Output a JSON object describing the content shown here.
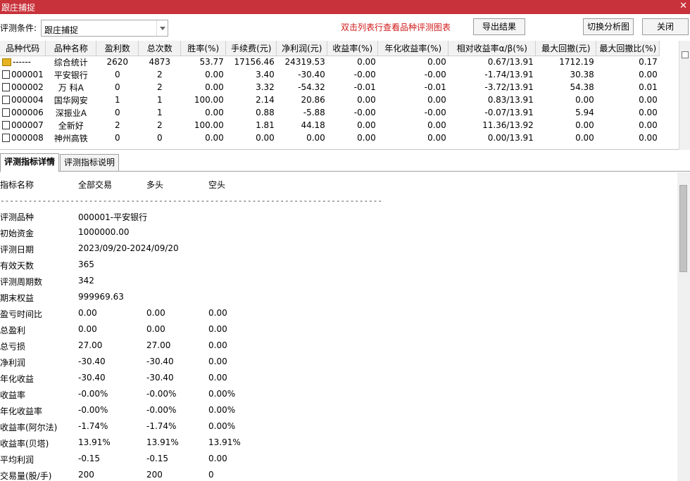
{
  "window": {
    "title": "跟庄捕捉",
    "close_glyph": "✕"
  },
  "toolbar": {
    "cond_label": "评测条件:",
    "cond_value": "跟庄捕捉",
    "hint": "双击列表行查看品种评测图表",
    "export_label": "导出结果",
    "switch_label": "切换分析图",
    "close_label": "关闭"
  },
  "table": {
    "headers": [
      "品种代码",
      "品种名称",
      "盈利数",
      "总次数",
      "胜率(%)",
      "手续费(元)",
      "净利润(元)",
      "收益率(%)",
      "年化收益率(%)",
      "相对收益率α/β(%)",
      "最大回撤(元)",
      "最大回撤比(%)"
    ],
    "rows": [
      [
        "------",
        "综合统计",
        "2620",
        "4873",
        "53.77",
        "17156.46",
        "24319.53",
        "0.00",
        "0.00",
        "0.67/13.91",
        "1712.19",
        "0.17"
      ],
      [
        "000001",
        "平安银行",
        "0",
        "2",
        "0.00",
        "3.40",
        "-30.40",
        "-0.00",
        "-0.00",
        "-1.74/13.91",
        "30.38",
        "0.00"
      ],
      [
        "000002",
        "万 科A",
        "0",
        "2",
        "0.00",
        "3.32",
        "-54.32",
        "-0.01",
        "-0.01",
        "-3.72/13.91",
        "54.38",
        "0.01"
      ],
      [
        "000004",
        "国华网安",
        "1",
        "1",
        "100.00",
        "2.14",
        "20.86",
        "0.00",
        "0.00",
        "0.83/13.91",
        "0.00",
        "0.00"
      ],
      [
        "000006",
        "深振业A",
        "0",
        "1",
        "0.00",
        "0.88",
        "-5.88",
        "-0.00",
        "-0.00",
        "-0.07/13.91",
        "5.94",
        "0.00"
      ],
      [
        "000007",
        "全新好",
        "2",
        "2",
        "100.00",
        "1.81",
        "44.18",
        "0.00",
        "0.00",
        "11.36/13.92",
        "0.00",
        "0.00"
      ],
      [
        "000008",
        "神州高铁",
        "0",
        "0",
        "0.00",
        "0.00",
        "0.00",
        "0.00",
        "0.00",
        "0.00/13.91",
        "0.00",
        "0.00"
      ]
    ]
  },
  "tabs": {
    "details": "评测指标详情",
    "description": "评测指标说明"
  },
  "detail": {
    "headers": [
      "指标名称",
      "全部交易",
      "多头",
      "空头"
    ],
    "separator": "----------------------------------------------------------------------------------",
    "rows": [
      [
        "评测品种",
        "000001-平安银行",
        "",
        ""
      ],
      [
        "初始资金",
        "1000000.00",
        "",
        ""
      ],
      [
        "评测日期",
        "2023/09/20-2024/09/20",
        "",
        ""
      ],
      [
        "有效天数",
        "365",
        "",
        ""
      ],
      [
        "评测周期数",
        "342",
        "",
        ""
      ],
      [
        "期末权益",
        "999969.63",
        "",
        ""
      ],
      [
        "盈亏时间比",
        "0.00",
        "0.00",
        "0.00"
      ],
      [
        "总盈利",
        "0.00",
        "0.00",
        "0.00"
      ],
      [
        "总亏损",
        "27.00",
        "27.00",
        "0.00"
      ],
      [
        "净利润",
        "-30.40",
        "-30.40",
        "0.00"
      ],
      [
        "年化收益",
        "-30.40",
        "-30.40",
        "0.00"
      ],
      [
        "收益率",
        "-0.00%",
        "-0.00%",
        "0.00%"
      ],
      [
        "年化收益率",
        "-0.00%",
        "-0.00%",
        "0.00%"
      ],
      [
        "收益率(阿尔法)",
        "-1.74%",
        "-1.74%",
        "0.00%"
      ],
      [
        "收益率(贝塔)",
        "13.91%",
        "13.91%",
        "13.91%"
      ],
      [
        "平均利润",
        "-0.15",
        "-0.15",
        "0.00"
      ],
      [
        "交易量(股/手)",
        "200",
        "200",
        "0"
      ]
    ]
  },
  "colors": {
    "titlebar": "#c8323a",
    "hint": "#d11a1a"
  }
}
